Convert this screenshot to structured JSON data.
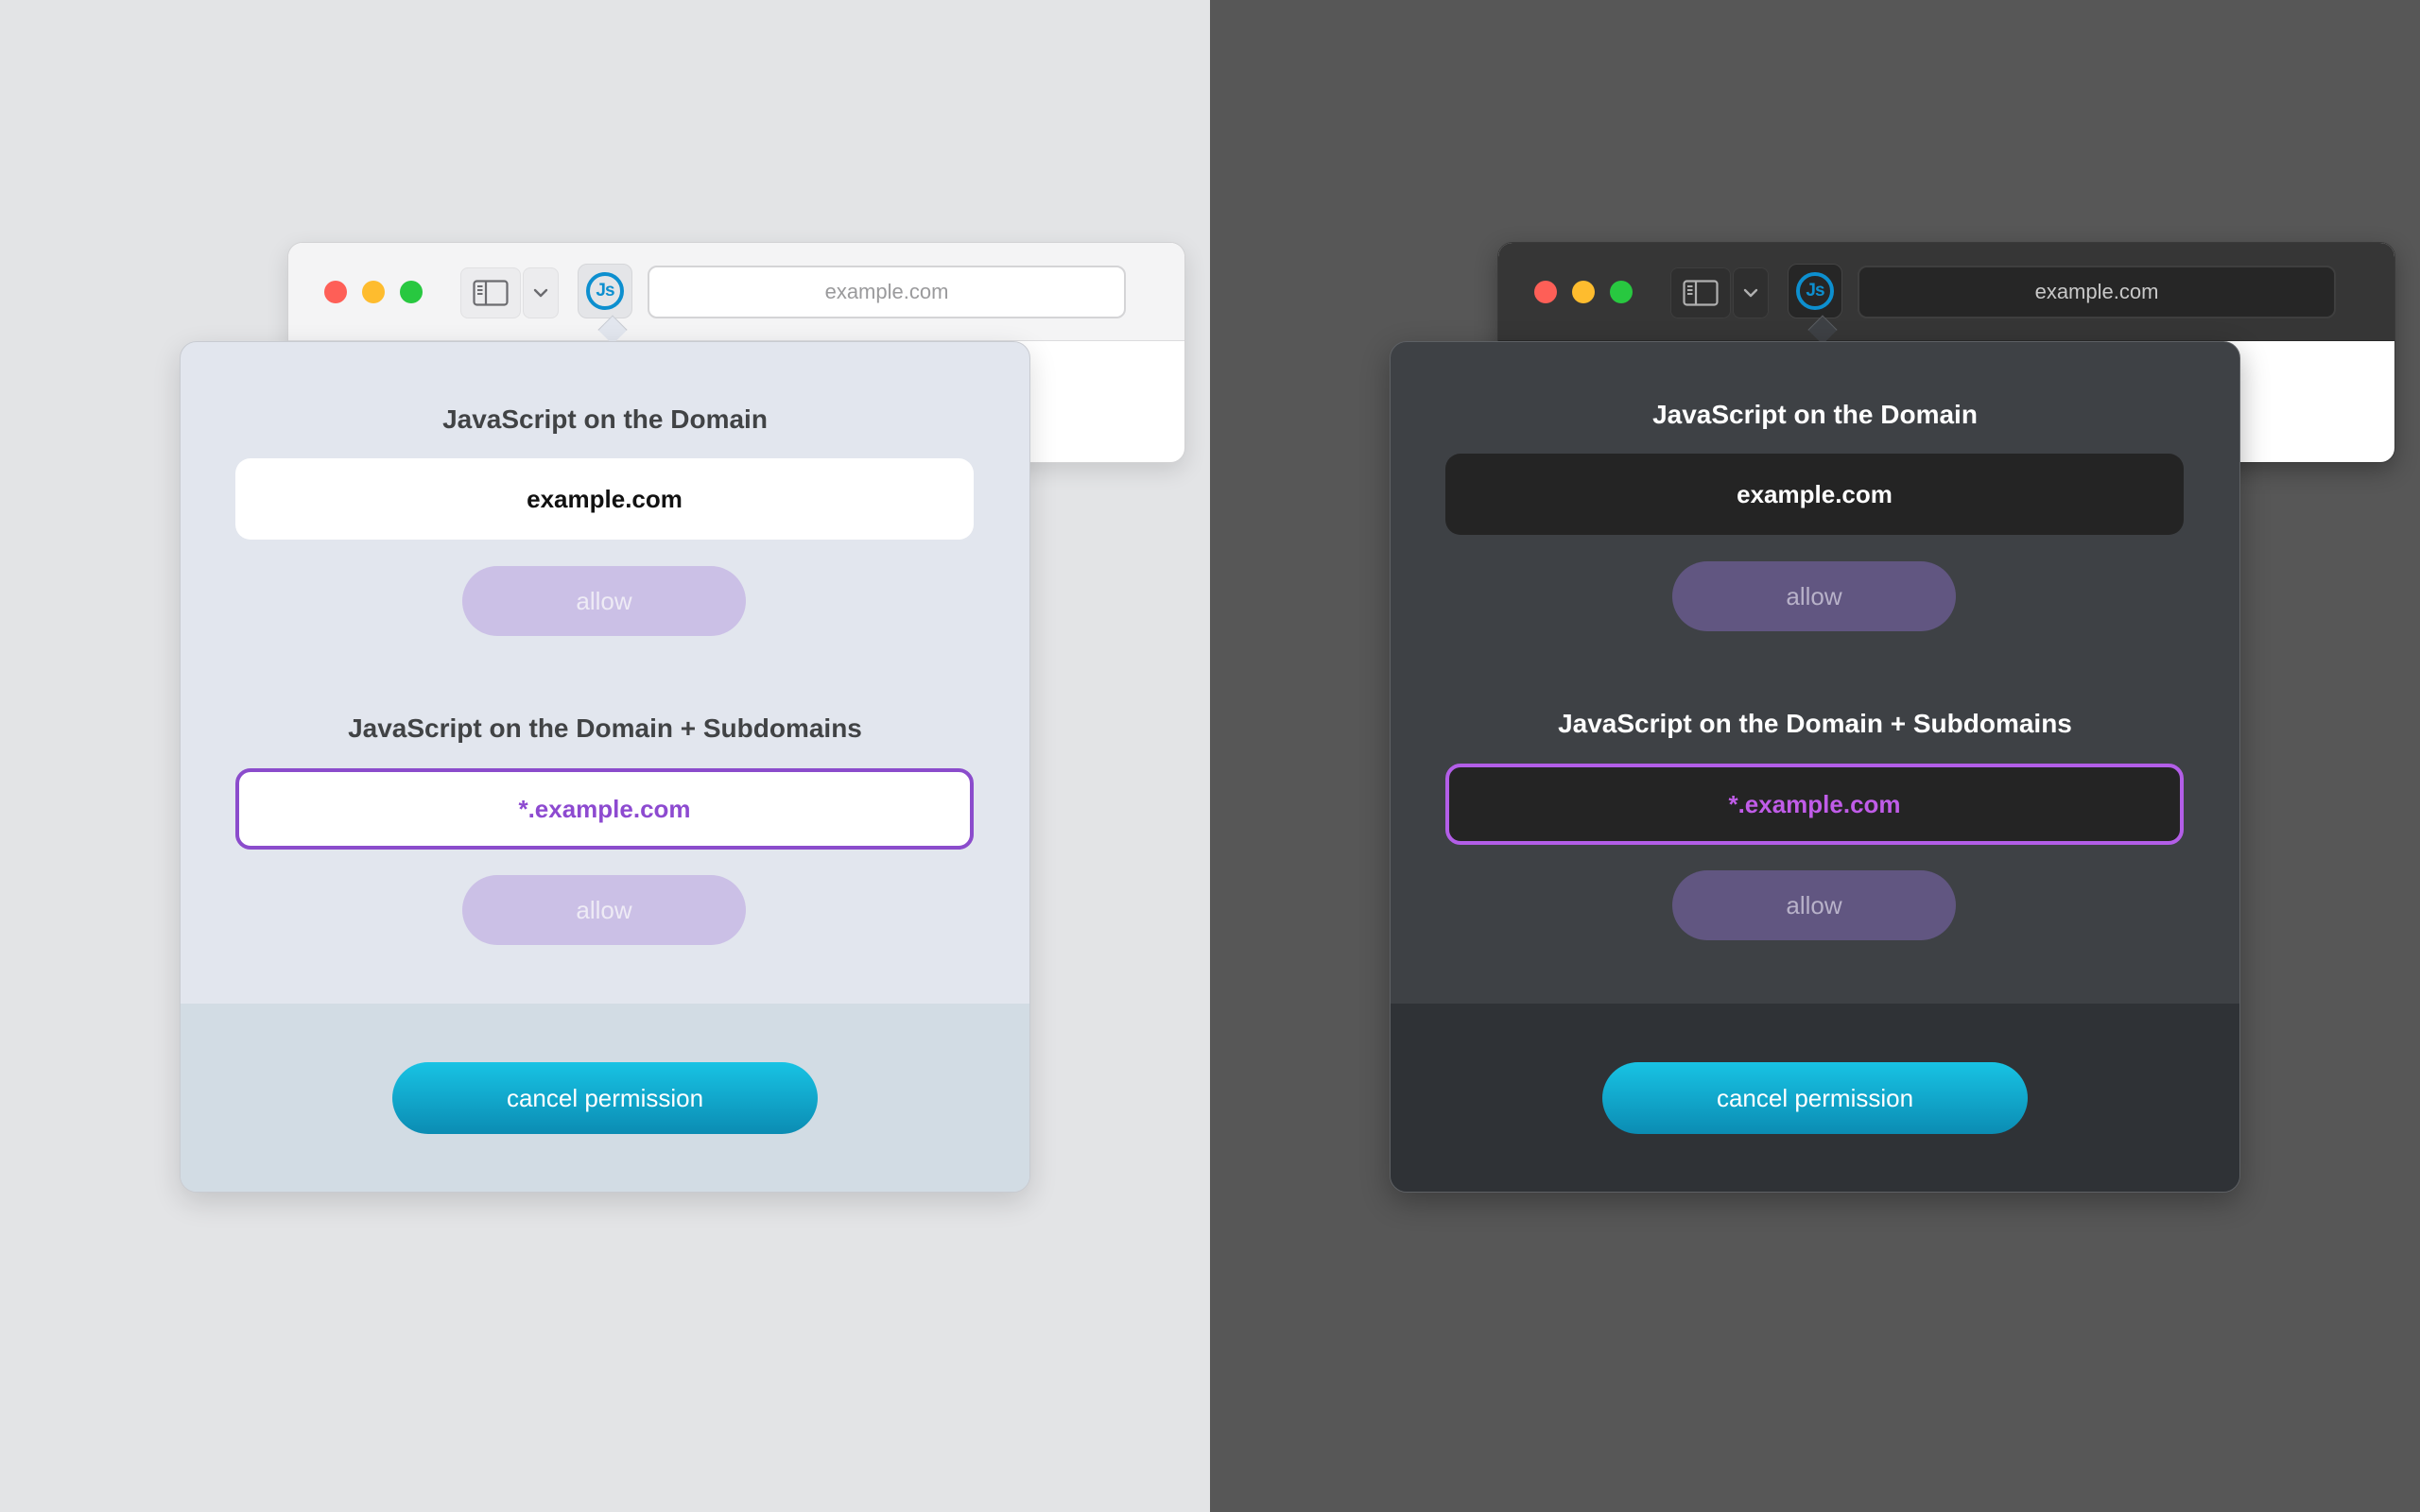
{
  "light": {
    "toolbar": {
      "url": "example.com",
      "extension_icon_label": "Js"
    },
    "popup": {
      "domain_section": {
        "title": "JavaScript on the Domain",
        "domain": "example.com",
        "allow_label": "allow"
      },
      "subdomain_section": {
        "title": "JavaScript on the Domain + Subdomains",
        "domain": "*.example.com",
        "allow_label": "allow"
      },
      "cancel_label": "cancel permission"
    }
  },
  "dark": {
    "toolbar": {
      "url": "example.com",
      "extension_icon_label": "Js"
    },
    "popup": {
      "domain_section": {
        "title": "JavaScript on the Domain",
        "domain": "example.com",
        "allow_label": "allow"
      },
      "subdomain_section": {
        "title": "JavaScript on the Domain + Subdomains",
        "domain": "*.example.com",
        "allow_label": "allow"
      },
      "cancel_label": "cancel permission"
    }
  },
  "icons": [
    "close-window-icon",
    "minimize-window-icon",
    "zoom-window-icon",
    "sidebar-icon",
    "chevron-down-icon",
    "javascript-extension-icon"
  ],
  "colors": {
    "light_background": "#e3e4e6",
    "dark_background": "#575757",
    "accent_purple": "#8d4ad0",
    "cancel_button": "#0b9fc6",
    "extension_icon": "#0d8fcf"
  }
}
